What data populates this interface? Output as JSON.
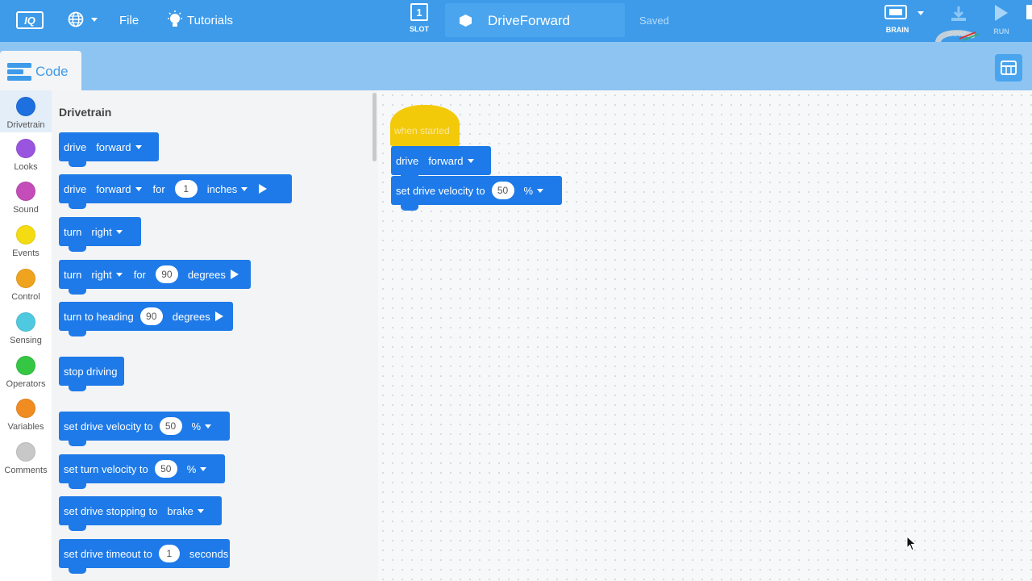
{
  "topbar": {
    "logo": "IQ",
    "file_label": "File",
    "tutorials_label": "Tutorials",
    "slot_number": "1",
    "slot_label": "SLOT",
    "project_name": "DriveForward",
    "save_status": "Saved",
    "brain_label": "BRAIN",
    "download_label": "DOWNLOAD",
    "run_label": "RUN",
    "icons": [
      "globe-icon",
      "lightbulb-icon",
      "brain-icon",
      "download-icon",
      "run-icon"
    ]
  },
  "subbar": {
    "code_tab_label": "Code",
    "colors": {
      "topbar": "#3d9be9",
      "subbar": "#8ec4f1"
    }
  },
  "categories": [
    {
      "label": "Drivetrain",
      "color": "#1e6fe0",
      "active": true
    },
    {
      "label": "Looks",
      "color": "#9a55e0"
    },
    {
      "label": "Sound",
      "color": "#c44db9"
    },
    {
      "label": "Events",
      "color": "#f5dc12"
    },
    {
      "label": "Control",
      "color": "#f0a31f"
    },
    {
      "label": "Sensing",
      "color": "#4fc9df"
    },
    {
      "label": "Operators",
      "color": "#35c644"
    },
    {
      "label": "Variables",
      "color": "#f08c22"
    },
    {
      "label": "Comments",
      "color": "#c8c8c8"
    }
  ],
  "palette": {
    "title": "Drivetrain",
    "blocks": [
      {
        "drive": "drive",
        "direction": "forward"
      },
      {
        "drive": "drive",
        "direction": "forward",
        "for": "for",
        "amount": "1",
        "unit": "inches"
      },
      {
        "turn": "turn",
        "direction": "right"
      },
      {
        "turn": "turn",
        "direction": "right",
        "for": "for",
        "amount": "90",
        "unit": "degrees"
      },
      {
        "text": "turn to heading",
        "amount": "90",
        "unit": "degrees"
      },
      {
        "text": "stop driving"
      },
      {
        "text": "set drive velocity to",
        "amount": "50",
        "unit": "%"
      },
      {
        "text": "set turn velocity to",
        "amount": "50",
        "unit": "%"
      },
      {
        "text": "set drive stopping to",
        "mode": "brake"
      },
      {
        "text": "set drive timeout to",
        "amount": "1",
        "unit": "seconds"
      }
    ]
  },
  "workspace": {
    "hat_label": "when started",
    "blocks": [
      {
        "drive": "drive",
        "direction": "forward"
      },
      {
        "text": "set drive velocity to",
        "amount": "50",
        "unit": "%"
      }
    ],
    "block_color": "#1e7ae8",
    "hat_color": "#f2ca0a"
  }
}
